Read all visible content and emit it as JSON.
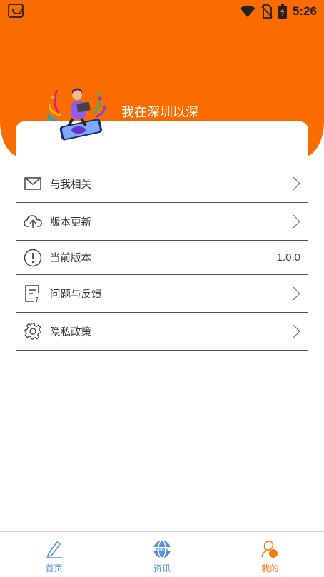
{
  "status_bar": {
    "time": "5:26",
    "icons": [
      "app-notification-icon",
      "wifi-icon",
      "no-sim-icon",
      "battery-charging-icon"
    ]
  },
  "profile": {
    "username": "我在深圳以深",
    "avatar": "illustration-person-with-laptop",
    "header_color": "#fb6c00"
  },
  "menu": {
    "items": [
      {
        "label": "与我相关",
        "icon": "mail-icon",
        "arrow": true
      },
      {
        "label": "版本更新",
        "icon": "cloud-upload-icon",
        "arrow": true
      },
      {
        "label": "当前版本",
        "icon": "info-circle-icon",
        "value": "1.0.0"
      },
      {
        "label": "问题与反馈",
        "icon": "feedback-doc-icon",
        "arrow": true
      },
      {
        "label": "隐私政策",
        "icon": "gear-icon",
        "arrow": true
      }
    ]
  },
  "tab_bar": {
    "tabs": [
      {
        "label": "首页",
        "icon": "pencil-icon",
        "active": false
      },
      {
        "label": "资讯",
        "icon": "news-globe-icon",
        "active": false
      },
      {
        "label": "我的",
        "icon": "profile-icon",
        "active": true
      }
    ],
    "active_color": "#f47b0b",
    "inactive_color": "#5b8fd6"
  }
}
